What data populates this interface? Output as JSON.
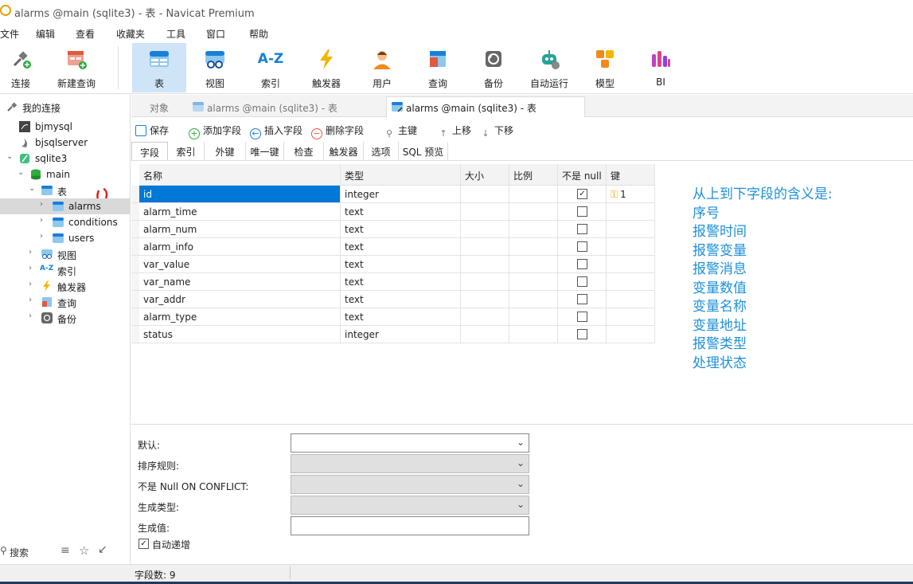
{
  "window": {
    "title": "alarms @main (sqlite3) - 表 - Navicat Premium"
  },
  "menu": [
    "文件",
    "编辑",
    "查看",
    "收藏夹",
    "工具",
    "窗口",
    "帮助"
  ],
  "toolbar": {
    "items": [
      "连接",
      "新建查询",
      "表",
      "视图",
      "索引",
      "触发器",
      "用户",
      "查询",
      "备份",
      "自动运行",
      "模型",
      "BI"
    ],
    "active": "表",
    "index_icon_text": "A-Z",
    "bi_icon_text": "BI"
  },
  "sidebar": {
    "root": "我的连接",
    "connections": [
      "bjmysql",
      "bjsqlserver",
      "sqlite3"
    ],
    "database": "main",
    "tables_group": "表",
    "tables": [
      "alarms",
      "conditions",
      "users"
    ],
    "groups": [
      "视图",
      "索引",
      "触发器",
      "查询",
      "备份"
    ],
    "search_placeholder": "搜索",
    "index_icon_text": "A-Z"
  },
  "tabs": [
    "对象",
    "alarms @main (sqlite3) - 表",
    "alarms @main (sqlite3) - 表"
  ],
  "actions": [
    "保存",
    "添加字段",
    "插入字段",
    "删除字段",
    "主键",
    "上移",
    "下移"
  ],
  "subtabs": [
    "字段",
    "索引",
    "外键",
    "唯一键",
    "检查",
    "触发器",
    "选项",
    "SQL 预览"
  ],
  "grid": {
    "headers": [
      "名称",
      "类型",
      "大小",
      "比例",
      "不是 null",
      "键"
    ],
    "rows": [
      {
        "name": "id",
        "type": "integer",
        "notnull": true,
        "key": "1"
      },
      {
        "name": "alarm_time",
        "type": "text",
        "notnull": false,
        "key": ""
      },
      {
        "name": "alarm_num",
        "type": "text",
        "notnull": false,
        "key": ""
      },
      {
        "name": "alarm_info",
        "type": "text",
        "notnull": false,
        "key": ""
      },
      {
        "name": "var_value",
        "type": "text",
        "notnull": false,
        "key": ""
      },
      {
        "name": "var_name",
        "type": "text",
        "notnull": false,
        "key": ""
      },
      {
        "name": "var_addr",
        "type": "text",
        "notnull": false,
        "key": ""
      },
      {
        "name": "alarm_type",
        "type": "text",
        "notnull": false,
        "key": ""
      },
      {
        "name": "status",
        "type": "integer",
        "notnull": false,
        "key": ""
      }
    ]
  },
  "annotation": {
    "lines": [
      "从上到下字段的含义是:",
      "序号",
      "报警时间",
      "报警变量",
      "报警消息",
      "变量数值",
      "变量名称",
      "变量地址",
      "报警类型",
      "处理状态"
    ],
    "color": "#1e90d8"
  },
  "properties": {
    "labels": [
      "默认:",
      "排序规则:",
      "不是 Null ON CONFLICT:",
      "生成类型:",
      "生成值:"
    ],
    "autoincrement_label": "自动递增",
    "autoincrement_checked": true
  },
  "status": {
    "field_count": "字段数: 9"
  }
}
